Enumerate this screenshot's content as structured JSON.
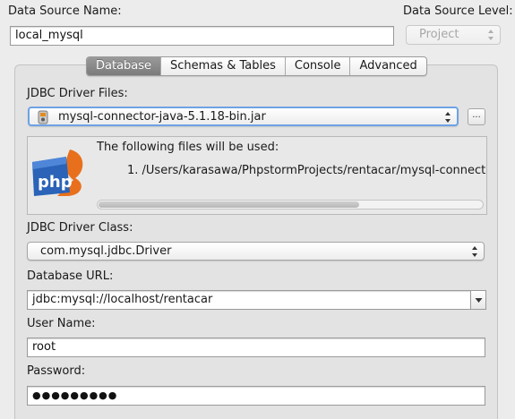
{
  "header": {
    "name_label": "Data Source Name:",
    "name_value": "local_mysql",
    "level_label": "Data Source Level:",
    "level_value": "Project"
  },
  "tabs": [
    {
      "label": "Database",
      "active": true
    },
    {
      "label": "Schemas & Tables",
      "active": false
    },
    {
      "label": "Console",
      "active": false
    },
    {
      "label": "Advanced",
      "active": false
    }
  ],
  "driver_files": {
    "label": "JDBC Driver Files:",
    "selected": "mysql-connector-java-5.1.18-bin.jar",
    "more_button": "...",
    "info_text": "The following files will be used:",
    "files": [
      "1.  /Users/karasawa/PhpstormProjects/rentacar/mysql-connect"
    ],
    "scroll_fraction": 0.68
  },
  "driver_class": {
    "label": "JDBC Driver Class:",
    "value": "com.mysql.jdbc.Driver"
  },
  "database_url": {
    "label": "Database URL:",
    "value": "jdbc:mysql://localhost/rentacar"
  },
  "user": {
    "label": "User Name:",
    "value": "root"
  },
  "password": {
    "label": "Password:",
    "value": "●●●●●●●●●"
  },
  "logo": {
    "text": "php",
    "accent": "#2a63b8",
    "flame": "#e8701d"
  }
}
